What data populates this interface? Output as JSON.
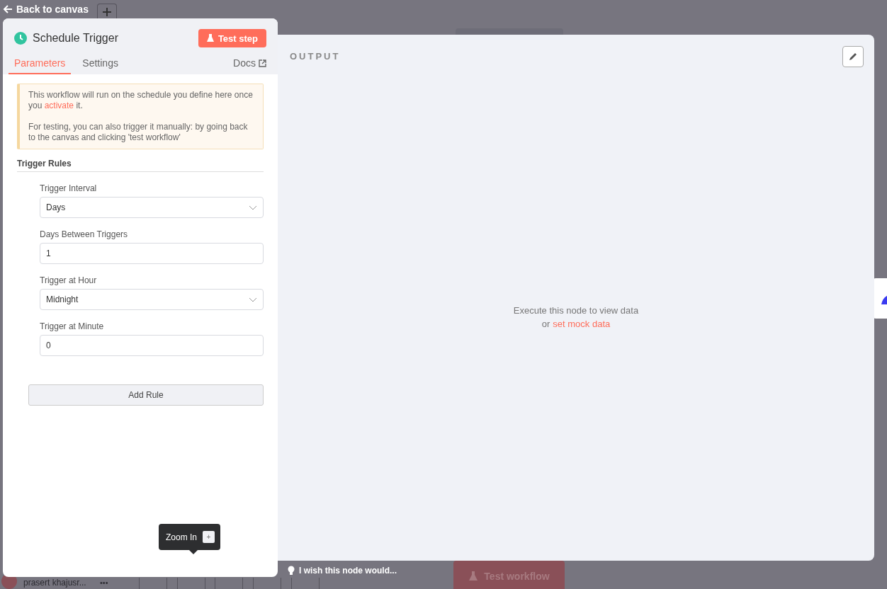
{
  "back_link": {
    "label": "Back to canvas"
  },
  "node_panel": {
    "title": "Schedule Trigger",
    "test_button": "Test step",
    "tabs": [
      {
        "label": "Parameters",
        "selected": true
      },
      {
        "label": "Settings",
        "selected": false
      }
    ],
    "docs_link": "Docs",
    "notice": {
      "before": "This workflow will run on the schedule you define here once you ",
      "link": "activate",
      "after": " it.",
      "second": "For testing, you can also trigger it manually: by going back to the canvas and clicking 'test workflow'"
    },
    "section_title": "Trigger Rules",
    "fields": [
      {
        "label": "Trigger Interval",
        "kind": "select",
        "value": "Days"
      },
      {
        "label": "Days Between Triggers",
        "kind": "number",
        "value": "1"
      },
      {
        "label": "Trigger at Hour",
        "kind": "select",
        "value": "Midnight"
      },
      {
        "label": "Trigger at Minute",
        "kind": "number",
        "value": "0"
      }
    ],
    "add_button": "Add Rule"
  },
  "output_panel": {
    "title": "OUTPUT",
    "empty_message": "Execute this node to view data",
    "or_text": "or",
    "mock_link": "set mock data"
  },
  "tooltip": {
    "label": "Zoom In",
    "key": "+"
  },
  "footer": {
    "user": "prasert khajusr...",
    "more": "•••",
    "feedback": "I wish this node would...",
    "test_workflow": "Test workflow"
  }
}
